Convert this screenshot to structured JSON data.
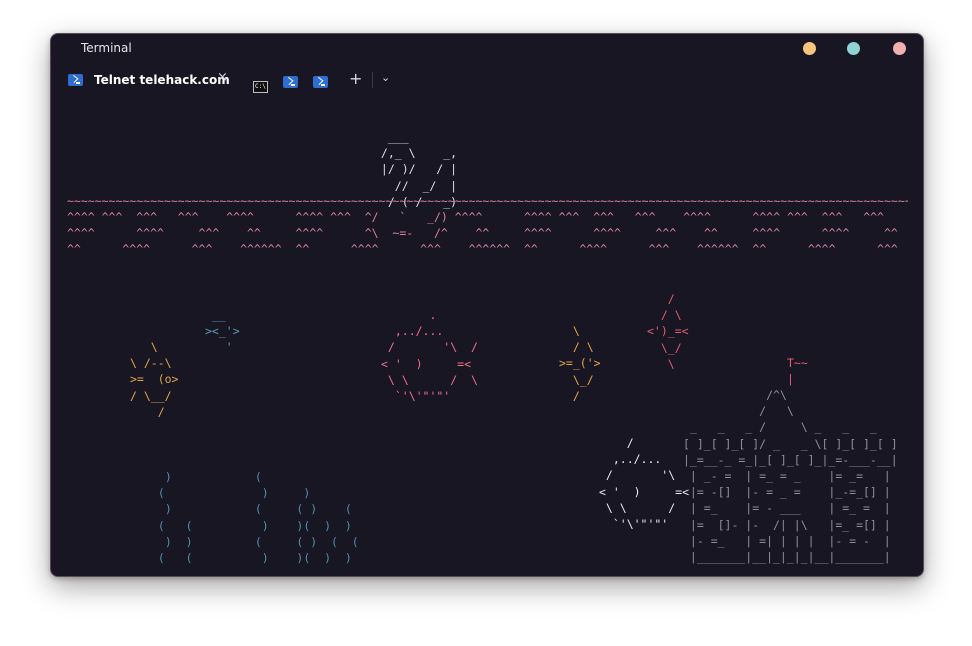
{
  "window": {
    "title": "Terminal",
    "controls": {
      "minimize_color": "#f9c57e",
      "maximize_color": "#8fd3d3",
      "close_color": "#f1b0b0"
    }
  },
  "tabs": {
    "active_label": "Telnet telehack.com",
    "active_icon": "powershell-icon",
    "close_glyph": "×",
    "profile_icons": [
      "cmd-icon",
      "powershell-icon",
      "powershell-icon"
    ],
    "cmd_glyph": "C:\\",
    "new_tab_glyph": "+",
    "dropdown_glyph": "⌄"
  },
  "colors": {
    "background": "#181622",
    "sea": "#d68396",
    "waves": "#d68396",
    "ship": "#dcdcf0",
    "fish_blue": "#5b9bb5",
    "fish_orange": "#e5a64a",
    "fish_pink": "#f0718c",
    "fish_white": "#e8e8f0",
    "fish_red": "#e35d72",
    "castle": "#8d8da0",
    "castle_accent": "#e5a64a",
    "seaweed": "#4f91ac"
  },
  "terminal": {
    "ship": "  ___\n /,_ \\    _,\n |/ )/   / |\n   //  _/  |\n  / ( /   _)",
    "water_line": "~~~~~~~~~~~~~~~~~~~~~~~~~~~~~~~~~~~~~~~~~~~~~~~~~~~~~~~~~~~~~~~~~~~~~~~~~~~~~~~~~~~~~~~~~~~~~~~~~~~~~~~~~~~~~~~~~~~~~~~~~~~~~~~~~~~~~~",
    "waves_1": "^^^^ ^^^  ^^^   ^^^    ^^^^      ^^^^ ^^^  ^/   `   _/) ^^^^      ^^^^ ^^^  ^^^   ^^^    ^^^^      ^^^^ ^^^  ^^^   ^^^",
    "waves_2": "^^^^      ^^^^     ^^^    ^^     ^^^^      ^\\  ~=-   /^    ^^     ^^^^      ^^^^     ^^^    ^^     ^^^^      ^^^^     ^^",
    "waves_3": "^^      ^^^^      ^^^    ^^^^^^  ^^      ^^^^      ^^^    ^^^^^^  ^^      ^^^^      ^^^    ^^^^^^  ^^      ^^^^      ^^^",
    "fish_small": " __\n><_'>\n   '",
    "fish_left": "   \\\n\\ /--\\\n>=  (o>\n/ \\__/\n    /",
    "fish_pink": "       .\n  ,../...\n /       '\\  /\n< '  )     =<\n \\ \\      /  \\\n  `'\\'\"'\"'",
    "fish_diamond": "  \\\n  / \\\n>=_('>\n  \\_/\n  /",
    "fish_top": "   /\n  / \\\n<')_=<\n  \\_/\n   \\",
    "fish_bottom": "    /\n  ,../...\n /       '\\\n< '  )     =<\n \\ \\      /\n  `'\\'\"'\"'",
    "seaweed": "  )            (\n (              )     )\n  )            (     ( )    (\n (   (          )    )(  )  )\n  )  )         (     ( )  (  (\n (   (          )    )(  )  )",
    "castle_flag": "T~~\n|",
    "castle": "            /^\\\n           /   \\\n _   _   _ /     \\ _   _   _\n[ ]_[ ]_[ ]/ _   _ \\[ ]_[ ]_[ ]\n|_=__-_ =_|_[ ]_[ ]_|_=-___-__|\n | _- =  | =_ = _    |= _=   |\n |= -[]  |- = _ =    |_-=_[] |\n | =_    |= - ___    | =_ =  |\n |=  []- |-  /| |\\   |=_ =[] |\n |- =_   | =| | | |  |- = -  |\n |_______|__|_|_|_|__|_______|"
  }
}
